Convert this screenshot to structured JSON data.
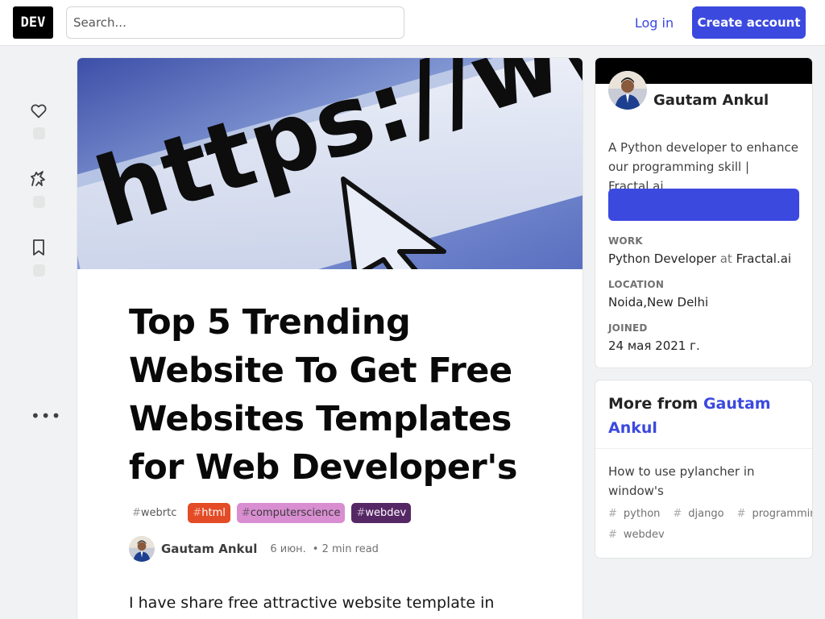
{
  "header": {
    "logo_text": "DEV",
    "search_placeholder": "Search...",
    "login_label": "Log in",
    "create_account_label": "Create account",
    "accent_color": "#3b49df"
  },
  "reactions": {
    "items": [
      {
        "icon": "heart-icon",
        "count": ""
      },
      {
        "icon": "unicorn-icon",
        "count": ""
      },
      {
        "icon": "bookmark-icon",
        "count": ""
      }
    ],
    "more_label": "•••"
  },
  "article": {
    "cover_text": "https://www",
    "title": "Top 5 Trending Website To Get Free Websites Templates for Web Developer's",
    "tags": [
      {
        "name": "webrtc",
        "color": "#ffffff"
      },
      {
        "name": "html",
        "color": "#e34c26"
      },
      {
        "name": "computerscience",
        "color": "#d98ed1"
      },
      {
        "name": "webdev",
        "color": "#562765"
      }
    ],
    "author_name": "Gautam Ankul",
    "date": "6 июн.",
    "read_time": "• 2 min read",
    "body_start": "I have share free attractive website template in which"
  },
  "profile": {
    "name": "Gautam Ankul",
    "bio": "A Python developer to enhance our programming skill | Fractal.ai",
    "follow_label": "",
    "work_label": "WORK",
    "work_title": "Python Developer",
    "work_at": "at",
    "work_company": "Fractal.ai",
    "location_label": "LOCATION",
    "location": "Noida,New Delhi",
    "joined_label": "JOINED",
    "joined": "24 мая 2021 г."
  },
  "more_from": {
    "prefix": "More from",
    "author": "Gautam Ankul",
    "post_title": "How to use pylancher in window's",
    "post_tags": [
      "python",
      "django",
      "programming",
      "webdev"
    ]
  }
}
